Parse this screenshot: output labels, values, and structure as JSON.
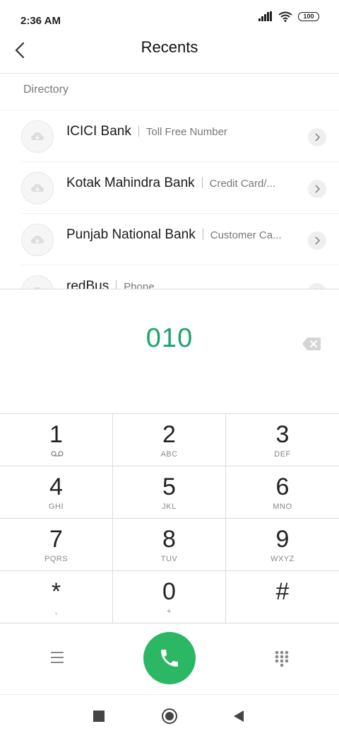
{
  "status_bar": {
    "time": "2:36 AM",
    "battery": "100"
  },
  "header": {
    "title": "Recents",
    "back_icon": "chevron-left-icon"
  },
  "directory": {
    "label": "Directory",
    "items": [
      {
        "name": "ICICI Bank",
        "sub": "Toll Free Number"
      },
      {
        "name": "Kotak Mahindra Bank",
        "sub": "Credit Card/..."
      },
      {
        "name": "Punjab National Bank",
        "sub": "Customer Ca..."
      },
      {
        "name": "redBus",
        "sub": "Phone"
      }
    ]
  },
  "dialer": {
    "number": "010"
  },
  "keypad": {
    "keys": [
      {
        "digit": "1",
        "letters": ""
      },
      {
        "digit": "2",
        "letters": "ABC"
      },
      {
        "digit": "3",
        "letters": "DEF"
      },
      {
        "digit": "4",
        "letters": "GHI"
      },
      {
        "digit": "5",
        "letters": "JKL"
      },
      {
        "digit": "6",
        "letters": "MNO"
      },
      {
        "digit": "7",
        "letters": "PQRS"
      },
      {
        "digit": "8",
        "letters": "TUV"
      },
      {
        "digit": "9",
        "letters": "WXYZ"
      },
      {
        "digit": "*",
        "letters": ","
      },
      {
        "digit": "0",
        "letters": "+"
      },
      {
        "digit": "#",
        "letters": ""
      }
    ]
  },
  "colors": {
    "accent": "#1aa36a",
    "call_button": "#2cb764"
  }
}
